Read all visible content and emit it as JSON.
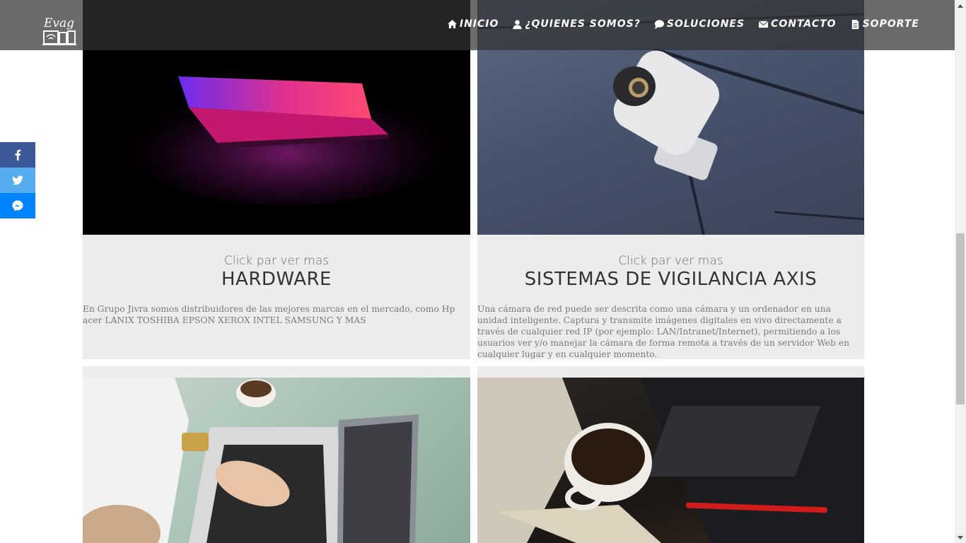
{
  "nav": {
    "items": [
      {
        "label": "INICIO",
        "icon": "home-icon"
      },
      {
        "label": "¿QUIENES SOMOS?",
        "icon": "user-icon"
      },
      {
        "label": "SOLUCIONES",
        "icon": "comment-icon"
      },
      {
        "label": "CONTACTO",
        "icon": "envelope-icon"
      },
      {
        "label": "SOPORTE",
        "icon": "file-icon"
      }
    ]
  },
  "logo": {
    "text": "Evag"
  },
  "cards": [
    {
      "sub": "Click par ver mas",
      "title": "HARDWARE",
      "description": "En Grupo Jivra somos distribuidores de las mejores marcas en el mercado, como Hp acer LANIX TOSHIBA EPSON XEROX INTEL SAMSUNG Y MAS"
    },
    {
      "sub": "Click par ver mas",
      "title": "SISTEMAS DE VIGILANCIA AXIS",
      "description": "Una cámara de red puede ser descrita como una cámara y un ordenador en una unidad inteligente. Captura y transmite imágenes digitales en vivo directamente a través de cualquier red IP (por ejemplo: LAN/Intranet/Internet), permitiendo a los usuarios ver y/o manejar la cámara de forma remota a través de un servidor Web en cualquier lugar y en cualquier momento."
    }
  ],
  "social": [
    {
      "name": "facebook",
      "color": "#3b5998"
    },
    {
      "name": "twitter",
      "color": "#55acee"
    },
    {
      "name": "messenger",
      "color": "#0084ff"
    }
  ]
}
